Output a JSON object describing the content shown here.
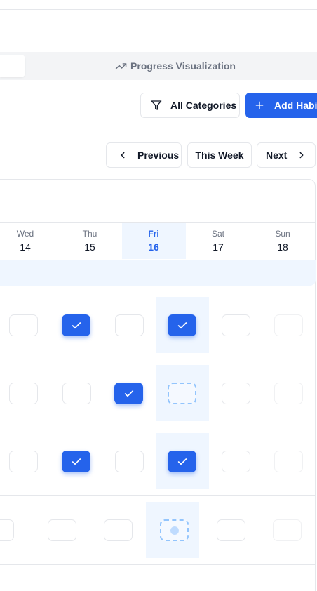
{
  "tabs": {
    "progress_label": "Progress Visualization"
  },
  "toolbar": {
    "category_label": "All Categories",
    "add_label": "Add Habit"
  },
  "nav": {
    "previous_label": "Previous",
    "this_week_label": "This Week",
    "next_label": "Next"
  },
  "week": {
    "days": [
      {
        "name": "Wed",
        "date": "14"
      },
      {
        "name": "Thu",
        "date": "15"
      },
      {
        "name": "Fri",
        "date": "16"
      },
      {
        "name": "Sat",
        "date": "17"
      },
      {
        "name": "Sun",
        "date": "18"
      }
    ],
    "today_index": 2
  },
  "habits": [
    {
      "states": [
        "empty",
        "checked",
        "empty",
        "checked",
        "empty",
        "faint"
      ]
    },
    {
      "states": [
        "empty",
        "empty",
        "checked",
        "pending",
        "empty",
        "faint"
      ]
    },
    {
      "states": [
        "empty",
        "checked",
        "empty",
        "checked",
        "empty",
        "faint"
      ]
    },
    {
      "states": [
        "empty",
        "empty",
        "empty",
        "pending-dot",
        "empty",
        "faint"
      ]
    }
  ],
  "colors": {
    "accent": "#2563eb",
    "today_bg": "#eff6ff",
    "border": "#e5e7eb",
    "muted_text": "#6b7280"
  },
  "icons": {
    "progress": "trending-up-icon",
    "filter": "filter-icon",
    "add": "plus-icon",
    "previous": "chevron-left-icon",
    "next": "chevron-right-icon",
    "check": "check-icon"
  }
}
